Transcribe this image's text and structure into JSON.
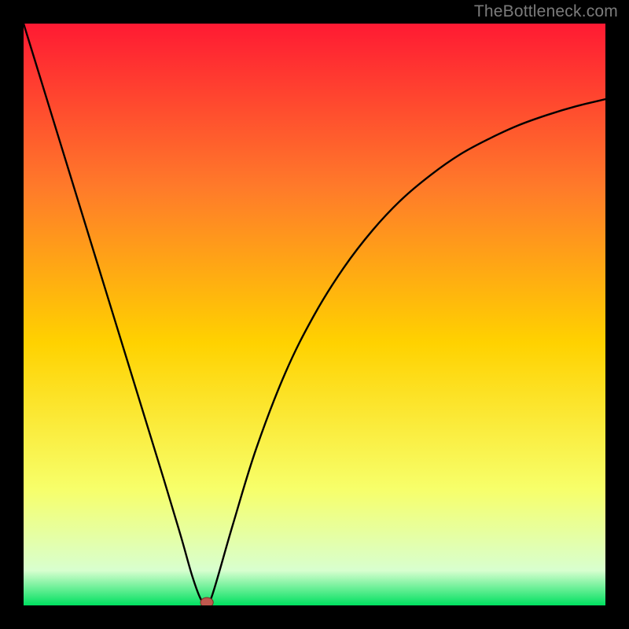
{
  "watermark": "TheBottleneck.com",
  "colors": {
    "frame_bg": "#000000",
    "curve": "#000000",
    "marker_fill": "#c0584e",
    "marker_stroke": "#7a2a22",
    "gradient_top": "#ff1a33",
    "gradient_mid_upper": "#ff7a2a",
    "gradient_mid": "#ffd200",
    "gradient_lower": "#f7ff6a",
    "gradient_pale": "#d8ffcf",
    "gradient_bottom": "#00e060"
  },
  "chart_data": {
    "type": "line",
    "title": "",
    "xlabel": "",
    "ylabel": "",
    "xlim": [
      0,
      100
    ],
    "ylim": [
      0,
      100
    ],
    "legend": false,
    "grid": false,
    "annotations": [],
    "series": [
      {
        "name": "curve",
        "x": [
          0,
          4,
          8,
          12,
          16,
          20,
          24,
          27,
          29,
          30.5,
          31.5,
          32.5,
          36,
          40,
          45,
          50,
          55,
          60,
          65,
          70,
          75,
          80,
          85,
          90,
          95,
          100
        ],
        "y": [
          100,
          87,
          74,
          61,
          48,
          35,
          22,
          12,
          5,
          1,
          0.5,
          2,
          14,
          27,
          40,
          50,
          58,
          64.5,
          69.8,
          74,
          77.5,
          80.2,
          82.5,
          84.3,
          85.8,
          87
        ]
      }
    ],
    "marker": {
      "x": 31.5,
      "y": 0.5,
      "rx": 1.1,
      "ry": 0.85
    }
  }
}
